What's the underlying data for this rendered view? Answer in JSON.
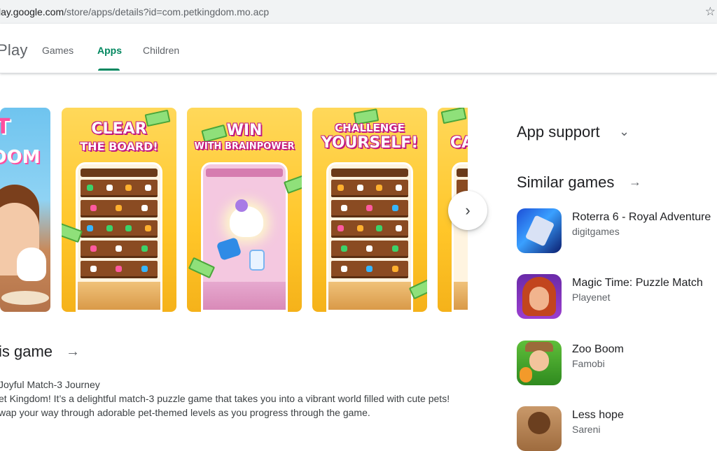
{
  "browser": {
    "url_host": "lay.google.com",
    "url_path": "/store/apps/details?id=com.petkingdom.mo.acp"
  },
  "header": {
    "brand": "Play",
    "tabs": [
      {
        "label": "Games"
      },
      {
        "label": "Apps",
        "active": true
      },
      {
        "label": "Children"
      }
    ]
  },
  "screenshots": [
    {
      "kind": "promo",
      "text_line1": "T",
      "text_line2": "DOM"
    },
    {
      "kind": "gameplay",
      "banner_line1": "CLEAR",
      "banner_line2": "THE BOARD!"
    },
    {
      "kind": "unicorn",
      "banner_line1": "WIN",
      "banner_line2": "WITH BRAINPOWER"
    },
    {
      "kind": "gameplay",
      "banner_line1": "CHALLENGE",
      "banner_line2": "YOURSELF!"
    },
    {
      "kind": "gameplay",
      "banner_line1": "CA",
      "banner_line2": ""
    }
  ],
  "about": {
    "title": "is game",
    "lines": [
      "Joyful Match-3 Journey",
      "et Kingdom! It’s a delightful match-3 puzzle game that takes you into a vibrant world filled with cute pets!",
      "wap your way through adorable pet-themed levels as you progress through the game."
    ]
  },
  "sidebar": {
    "app_support": "App support",
    "similar_games": "Similar games",
    "games": [
      {
        "name": "Roterra 6 - Royal Adventure",
        "developer": "digitgames"
      },
      {
        "name": "Magic Time: Puzzle Match",
        "developer": "Playenet"
      },
      {
        "name": "Zoo Boom",
        "developer": "Famobi"
      },
      {
        "name": "Less hope",
        "developer": "Sareni"
      }
    ]
  },
  "colors": {
    "accent": "#01875f",
    "text": "#202124",
    "muted": "#5f6368"
  }
}
